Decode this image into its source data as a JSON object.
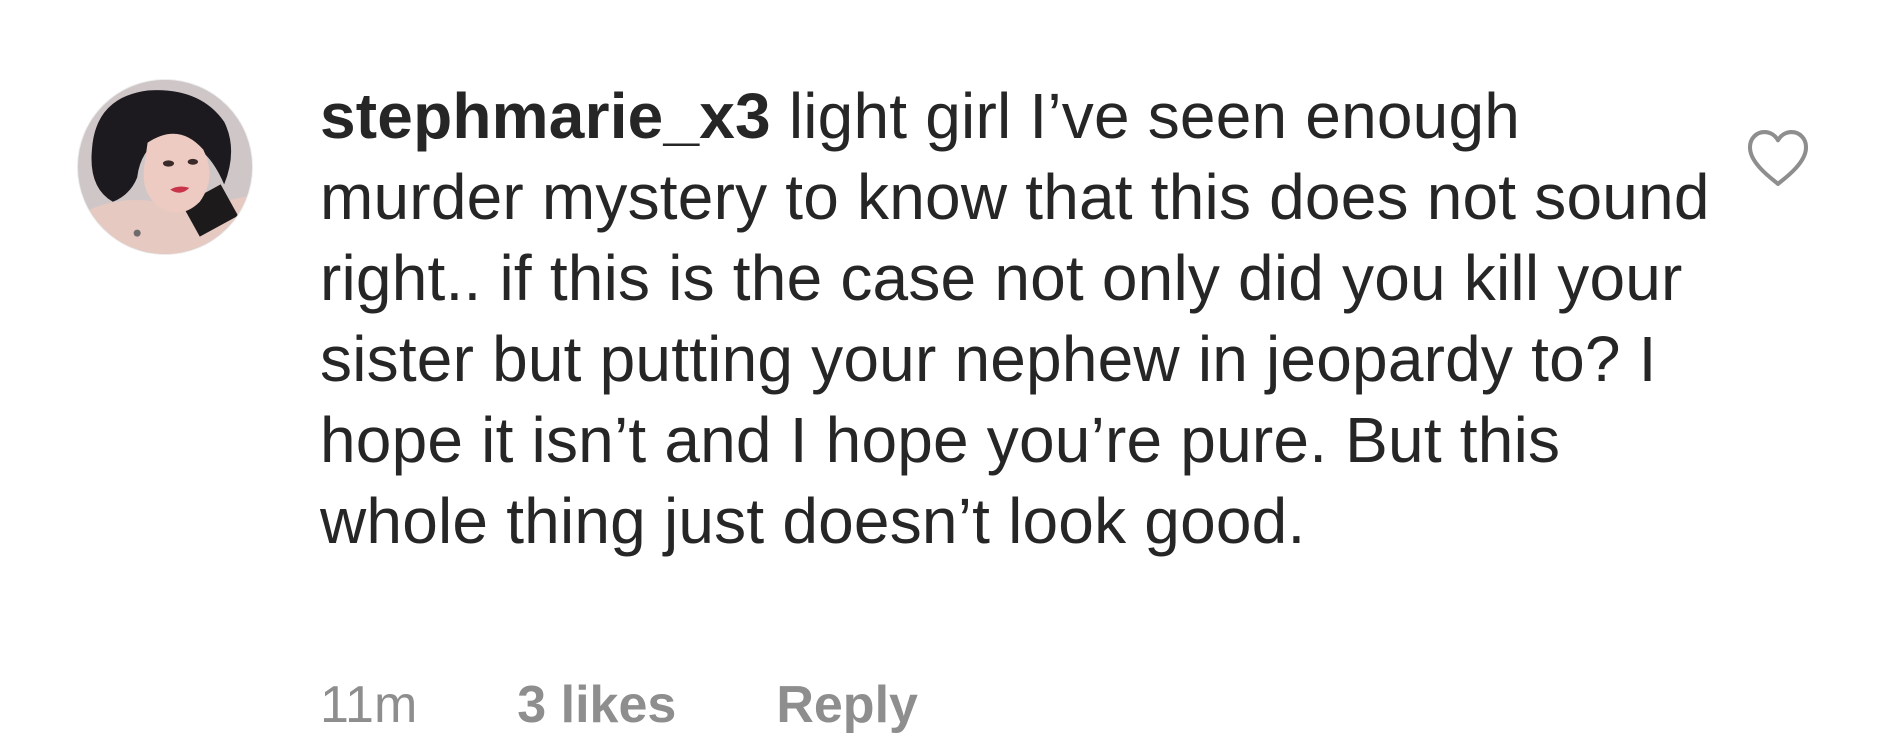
{
  "comment": {
    "username": "stephmarie_x3",
    "text": " light girl I’ve seen enough murder mystery to know that this does not sound right.. if this is the case not only did you kill your sister but putting your nephew in jeopardy to? I hope it isn’t and I hope you’re pure. But this whole thing just doesn’t look good.",
    "timestamp": "11m",
    "likes": "3 likes",
    "reply_label": "Reply",
    "avatar_icon": "profile-photo",
    "like_icon": "heart-outline-icon"
  },
  "colors": {
    "text": "#262626",
    "meta": "#8e8e8e",
    "heart": "#8e8e8e",
    "background": "#ffffff"
  }
}
